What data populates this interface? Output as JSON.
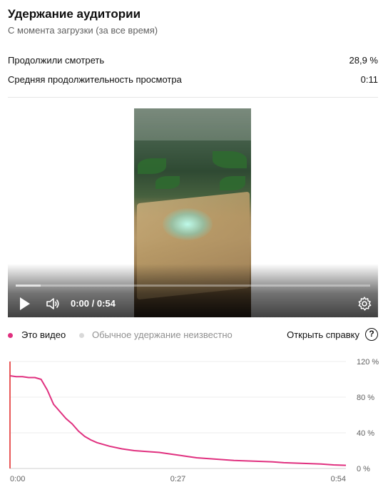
{
  "header": {
    "title": "Удержание аудитории",
    "subtitle": "С момента загрузки (за все время)"
  },
  "metrics": [
    {
      "label": "Продолжили смотреть",
      "value": "28,9 %"
    },
    {
      "label": "Средняя продолжительность просмотра",
      "value": "0:11"
    }
  ],
  "player": {
    "time": "0:00 / 0:54",
    "watched_fraction": 0.07,
    "icons": [
      "play-icon",
      "volume-icon",
      "settings-icon"
    ]
  },
  "legend": {
    "this_video": "Это видео",
    "typical": "Обычное удержание неизвестно",
    "help": "Открыть справку",
    "help_icon": "?"
  },
  "colors": {
    "accent": "#e0307f",
    "typical": "#d9d9d9",
    "marker": "#e02020"
  },
  "chart_data": {
    "type": "line",
    "title": "",
    "xlabel": "",
    "ylabel": "",
    "xlim": [
      0,
      54
    ],
    "ylim": [
      0,
      120
    ],
    "x_ticks": [
      "0:00",
      "0:27",
      "0:54"
    ],
    "y_ticks": [
      "120 %",
      "80 %",
      "40 %",
      "0 %"
    ],
    "y_tick_values": [
      120,
      80,
      40,
      0
    ],
    "grid": true,
    "series": [
      {
        "name": "Это видео",
        "x": [
          0,
          1,
          2,
          3,
          4,
          5,
          6,
          7,
          8,
          9,
          10,
          11,
          12,
          13,
          14,
          16,
          18,
          20,
          22,
          24,
          26,
          28,
          30,
          32,
          34,
          36,
          38,
          40,
          42,
          44,
          46,
          48,
          50,
          52,
          54
        ],
        "values": [
          104,
          103,
          103,
          102,
          102,
          100,
          88,
          72,
          64,
          56,
          50,
          42,
          36,
          32,
          29,
          25,
          22,
          20,
          19,
          18,
          16,
          14,
          12,
          11,
          10,
          9,
          8.5,
          8,
          7.5,
          6.5,
          6,
          5.5,
          5,
          4,
          3.5
        ]
      }
    ]
  }
}
